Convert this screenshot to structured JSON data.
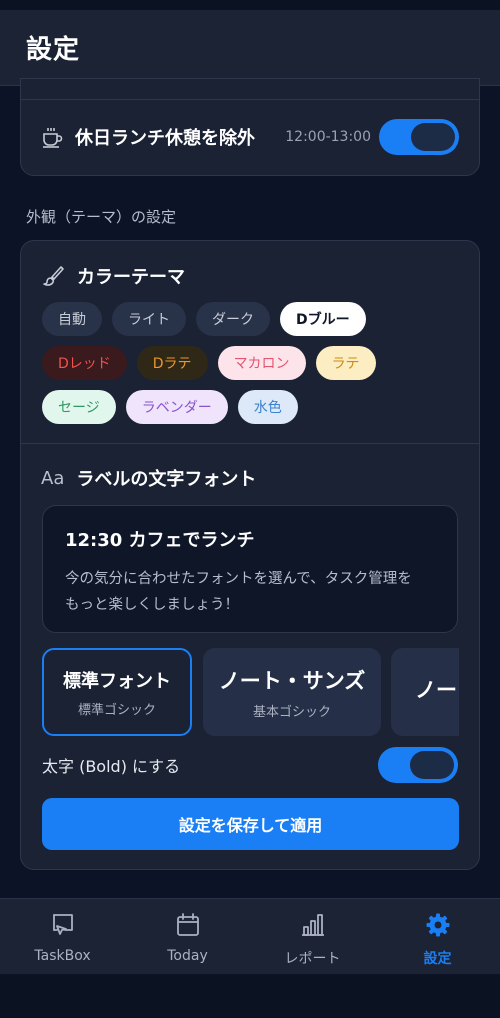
{
  "header": {
    "title": "設定"
  },
  "holiday": {
    "label": "休日ランチ休憩を除外",
    "time_range": "12:00-13:00",
    "enabled": true
  },
  "appearance": {
    "section_title": "外観（テーマ）の設定",
    "color_theme": {
      "label": "カラーテーマ",
      "selected": "Dブルー",
      "options": [
        "自動",
        "ライト",
        "ダーク",
        "Dブルー",
        "Dレッド",
        "Dラテ",
        "マカロン",
        "ラテ",
        "セージ",
        "ラベンダー",
        "水色"
      ]
    },
    "label_font": {
      "label": "ラベルの文字フォント",
      "preview_title": "12:30 カフェでランチ",
      "preview_body_line1": "今の気分に合わせたフォントを選んで、タスク管理を",
      "preview_body_line2": "もっと楽しくしましょう！",
      "fonts": [
        {
          "name": "標準フォント",
          "sub": "標準ゴシック"
        },
        {
          "name": "ノート・サンズ",
          "sub": "基本ゴシック"
        },
        {
          "name": "ノー",
          "sub": ""
        }
      ],
      "selected": "標準フォント"
    },
    "bold": {
      "label": "太字 (Bold) にする",
      "enabled": true
    },
    "save_button": "設定を保存して適用"
  },
  "tabs": [
    {
      "label": "TaskBox",
      "icon": "taskbox-icon"
    },
    {
      "label": "Today",
      "icon": "calendar-icon"
    },
    {
      "label": "レポート",
      "icon": "bar-chart-icon"
    },
    {
      "label": "設定",
      "icon": "gear-icon",
      "active": true
    }
  ],
  "colors": {
    "accent": "#1a7ff5",
    "background": "#0c1326",
    "card": "#1a2234"
  }
}
